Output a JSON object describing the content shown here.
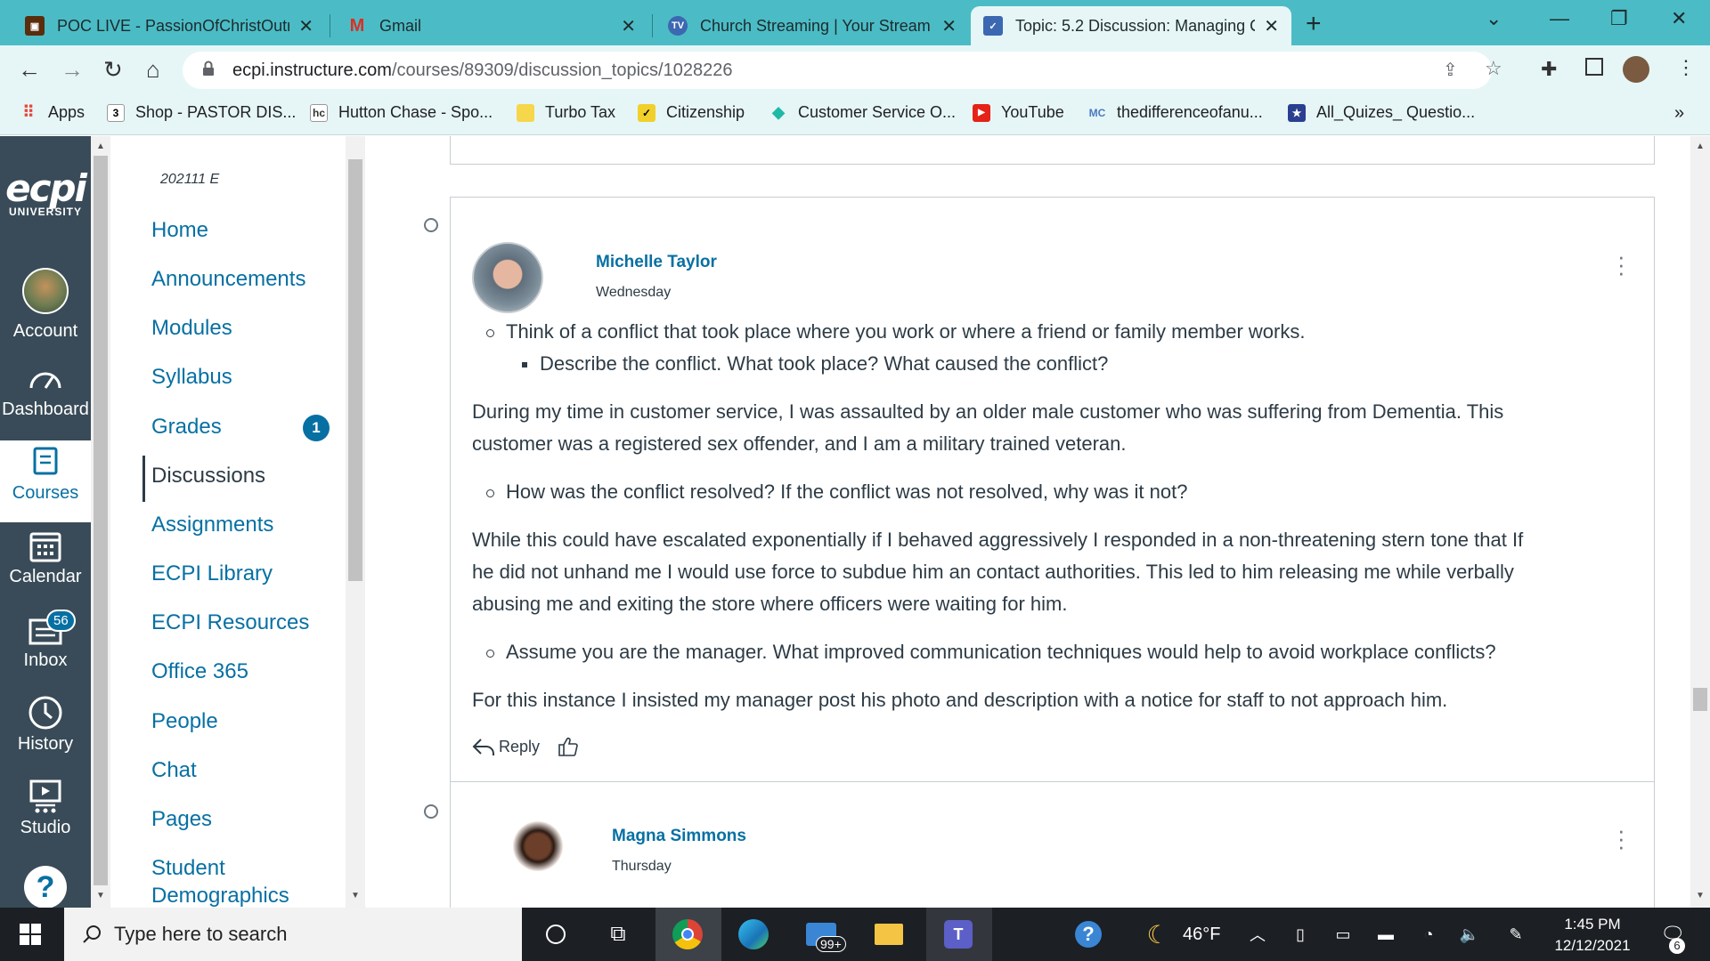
{
  "browser": {
    "tabs": [
      {
        "title": "POC LIVE - PassionOfChristOutre",
        "favicon": "poc-favicon-icon"
      },
      {
        "title": "Gmail",
        "favicon": "gmail-icon"
      },
      {
        "title": "Church Streaming | Your Stream",
        "favicon": "tv-icon"
      },
      {
        "title": "Topic: 5.2 Discussion: Managing C",
        "favicon": "canvas-shield-icon",
        "active": true
      }
    ],
    "url_host": "ecpi.instructure.com",
    "url_path": "/courses/89309/discussion_topics/1028226",
    "bookmarks": [
      {
        "label": "Apps"
      },
      {
        "label": "Shop - PASTOR DIS..."
      },
      {
        "label": "Hutton Chase - Spo..."
      },
      {
        "label": "Turbo Tax"
      },
      {
        "label": "Citizenship"
      },
      {
        "label": "Customer Service O..."
      },
      {
        "label": "YouTube"
      },
      {
        "label": "thedifferenceofanu..."
      },
      {
        "label": "All_Quizes_ Questio..."
      }
    ],
    "bookmarks_overflow": "»"
  },
  "global_nav": {
    "logo_big": "ecpi",
    "logo_small": "UNIVERSITY",
    "items": [
      {
        "label": "Account"
      },
      {
        "label": "Dashboard"
      },
      {
        "label": "Courses"
      },
      {
        "label": "Calendar"
      },
      {
        "label": "Inbox",
        "badge": "56"
      },
      {
        "label": "History"
      },
      {
        "label": "Studio"
      }
    ],
    "help_glyph": "?"
  },
  "course_nav": {
    "code": "202111 E",
    "items": [
      {
        "label": "Home"
      },
      {
        "label": "Announcements"
      },
      {
        "label": "Modules"
      },
      {
        "label": "Syllabus"
      },
      {
        "label": "Grades",
        "badge": "1"
      },
      {
        "label": "Discussions"
      },
      {
        "label": "Assignments"
      },
      {
        "label": "ECPI Library"
      },
      {
        "label": "ECPI Resources"
      },
      {
        "label": "Office 365"
      },
      {
        "label": "People"
      },
      {
        "label": "Chat"
      },
      {
        "label": "Pages"
      },
      {
        "label": "Student"
      },
      {
        "label": "Demographics"
      }
    ]
  },
  "discussion": {
    "entries": [
      {
        "author": "Michelle Taylor",
        "date": "Wednesday",
        "bullet1": "Think of a conflict that took place where you work or where a friend or family member works.",
        "bullet1_sub": "Describe the conflict. What took place? What caused the conflict?",
        "para1_line1": "During my time in customer service, I was assaulted by an older male customer who was suffering from Dementia. This",
        "para1_line2": "customer was a registered sex offender, and I am a military trained veteran.",
        "bullet2": "How was the conflict resolved? If the conflict was not resolved, why was it not?",
        "para2_line1": "While this could have escalated exponentially if I behaved aggressively I responded in a non-threatening stern tone that If",
        "para2_line2": "he did not unhand me I would use force to subdue him an contact authorities. This led to him releasing me while verbally",
        "para2_line3": "abusing me and exiting the store where officers were waiting for him.",
        "bullet3": "Assume you are the manager. What improved communication techniques would help to avoid workplace conflicts?",
        "para3": "For this instance I insisted my manager post his photo and description with a notice for staff to not approach him.",
        "reply_label": "Reply"
      },
      {
        "author": "Magna Simmons",
        "date": "Thursday"
      }
    ]
  },
  "taskbar": {
    "search_placeholder": "Type here to search",
    "mail_badge": "99+",
    "weather": "46°F",
    "time": "1:45 PM",
    "date": "12/12/2021",
    "notif_count": "6"
  }
}
